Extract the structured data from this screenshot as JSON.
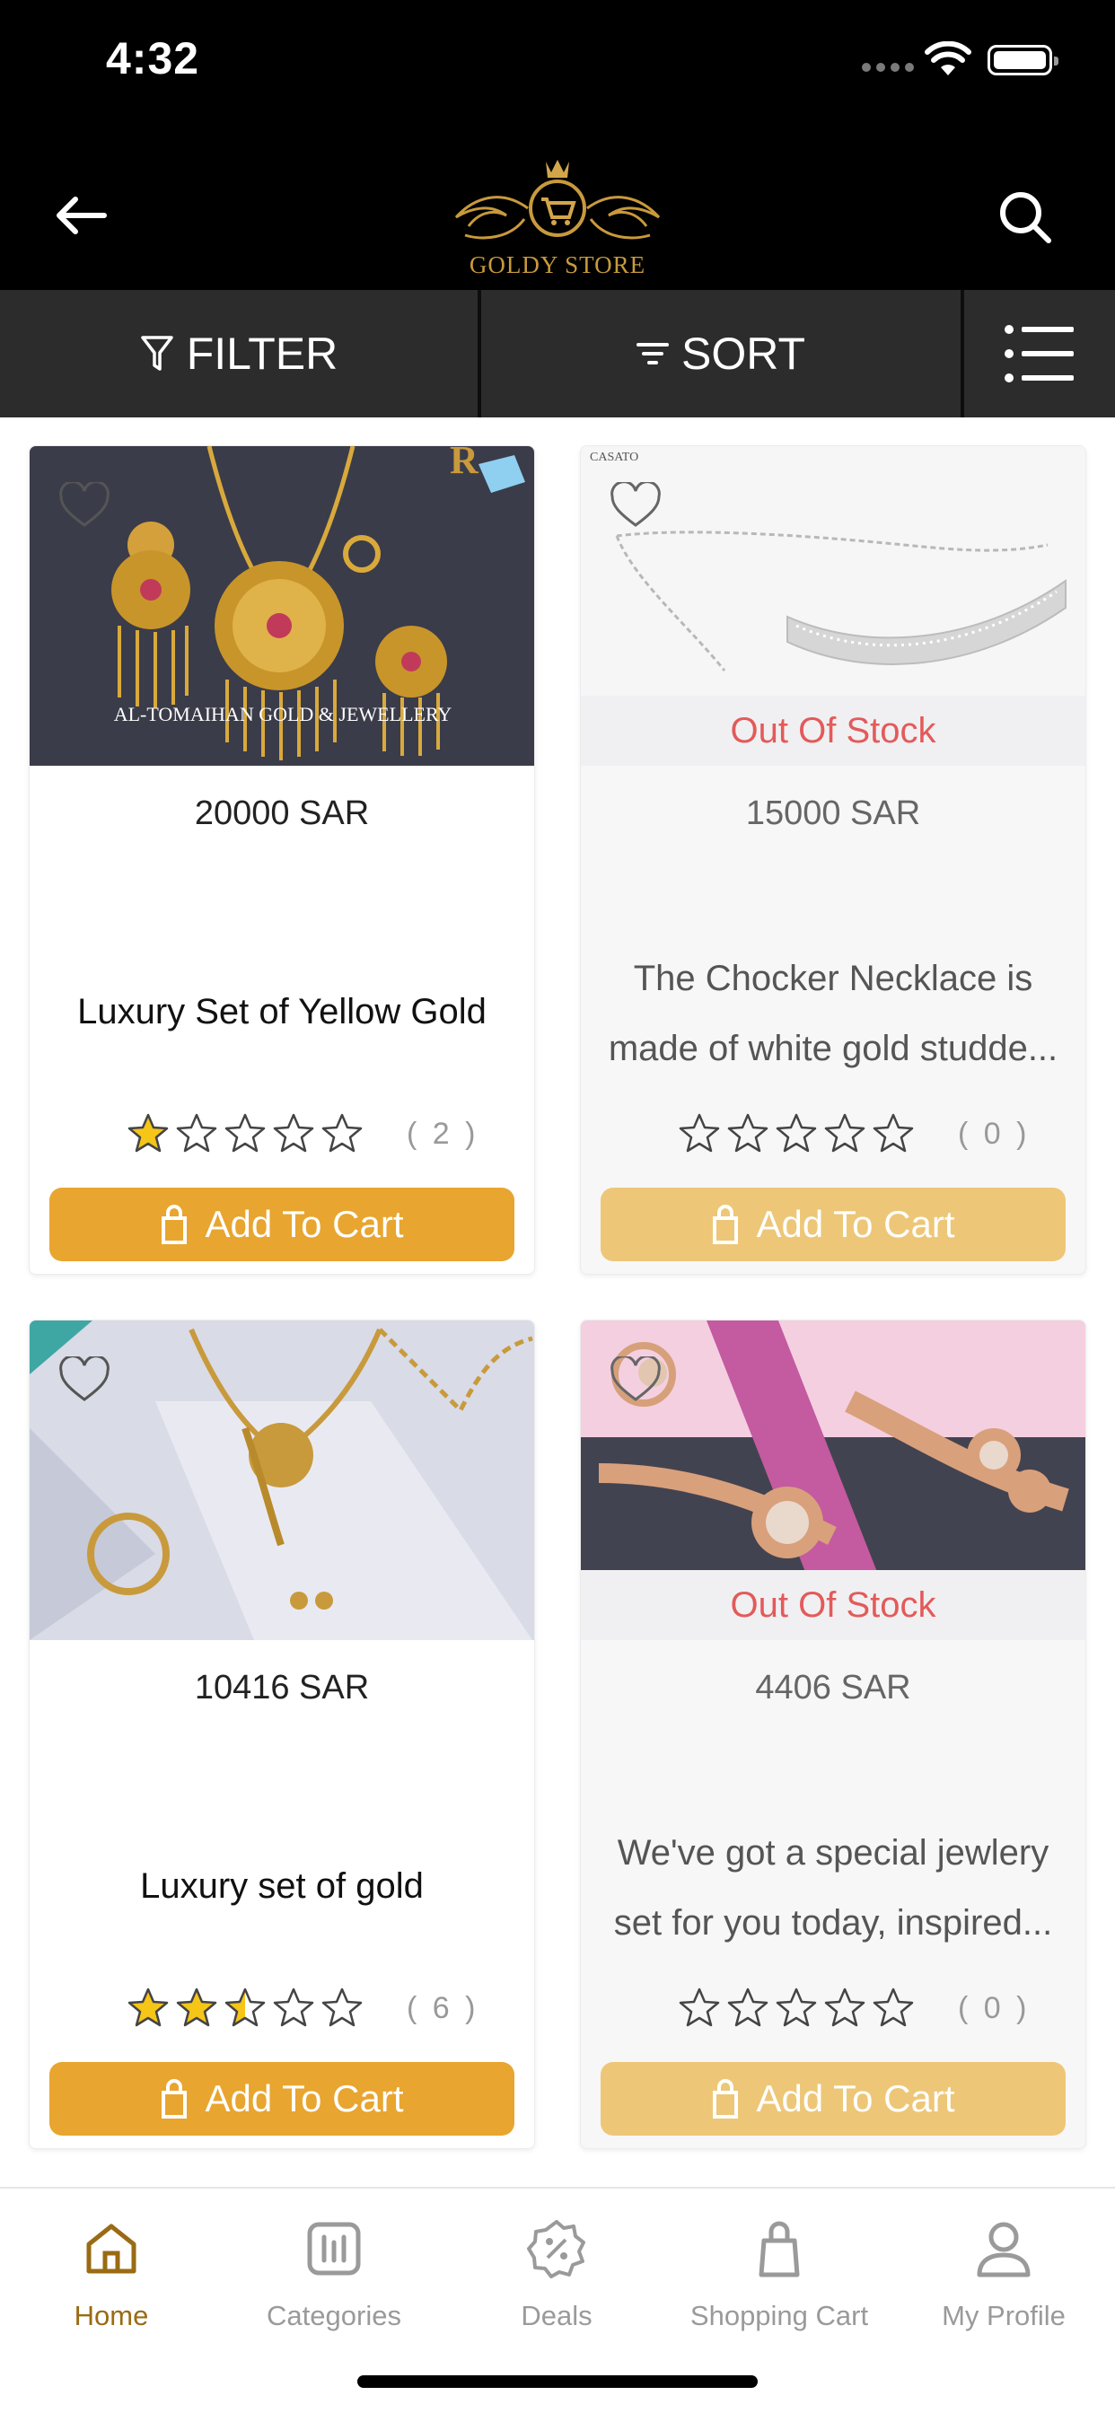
{
  "status_bar": {
    "time": "4:32"
  },
  "header": {
    "back_icon": "arrow-left-icon",
    "logo_text": "GOLDY STORE",
    "search_icon": "search-icon"
  },
  "toolbar": {
    "filter_label": "FILTER",
    "sort_label": "SORT",
    "view_icon": "list-view-icon"
  },
  "products": [
    {
      "price": "20000 SAR",
      "name": "Luxury Set of Yellow Gold",
      "stock": "",
      "rating": 1,
      "rating_count": "( 2 )",
      "button": "Add To Cart",
      "image_watermark": "AL-TOMAIHAN GOLD & JEWELLERY"
    },
    {
      "price": "15000 SAR",
      "name": "The Chocker Necklace is made of white gold studde...",
      "stock": "Out Of Stock",
      "rating": 0,
      "rating_count": "( 0 )",
      "button": "Add To Cart",
      "image_brand": "CASATO"
    },
    {
      "price": "10416 SAR",
      "name": "Luxury set of gold",
      "stock": "",
      "rating": 2.5,
      "rating_count": "( 6 )",
      "button": "Add To Cart"
    },
    {
      "price": "4406 SAR",
      "name": "We've got a special jewlery set for you today, inspired...",
      "stock": "Out Of Stock",
      "rating": 0,
      "rating_count": "( 0 )",
      "button": "Add To Cart"
    }
  ],
  "bottom_nav": [
    {
      "label": "Home",
      "icon": "home-icon",
      "active": true
    },
    {
      "label": "Categories",
      "icon": "categories-icon",
      "active": false
    },
    {
      "label": "Deals",
      "icon": "deals-icon",
      "active": false
    },
    {
      "label": "Shopping Cart",
      "icon": "shopping-bag-icon",
      "active": false
    },
    {
      "label": "My Profile",
      "icon": "profile-icon",
      "active": false
    }
  ],
  "colors": {
    "accent": "#e8a52f",
    "accent_disabled": "#edc777",
    "out_of_stock": "#e35a5a",
    "nav_active": "#9a6b14",
    "header_bg": "#000000",
    "toolbar_bg": "#2c2c2c"
  }
}
